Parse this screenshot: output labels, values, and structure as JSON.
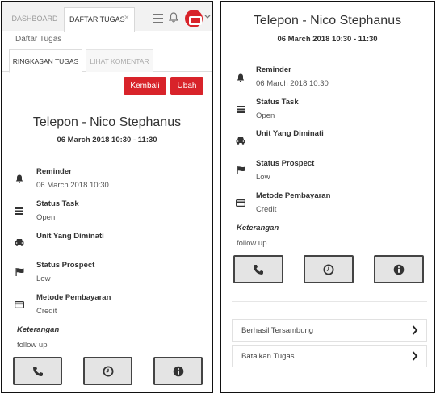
{
  "left": {
    "tabs": {
      "dashboard": "DASHBOARD",
      "daftar": "DAFTAR TUGAS",
      "close": "×"
    },
    "page_subtitle": "Daftar Tugas",
    "subtabs": {
      "ringkasan": "RINGKASAN TUGAS",
      "komentar": "LIHAT KOMENTAR"
    },
    "buttons": {
      "kembali": "Kembali",
      "ubah": "Ubah"
    },
    "accent": "#d8232a"
  },
  "task": {
    "title": "Telepon - Nico Stephanus",
    "datetime": "06 March 2018 10:30 - 11:30",
    "fields": [
      {
        "icon": "bell-icon",
        "label": "Reminder",
        "value": "06 March 2018 10:30"
      },
      {
        "icon": "list-icon",
        "label": "Status Task",
        "value": "Open"
      },
      {
        "icon": "car-icon",
        "label": "Unit Yang Diminati",
        "value": ""
      },
      {
        "icon": "flag-icon",
        "label": "Status Prospect",
        "value": "Low"
      },
      {
        "icon": "credit-card-icon",
        "label": "Metode Pembayaran",
        "value": "Credit"
      }
    ],
    "keterangan_label": "Keterangan",
    "keterangan_value": "follow up"
  },
  "actions": [
    "phone-icon",
    "clock-icon",
    "info-icon"
  ],
  "right": {
    "list_items": [
      "Berhasil Tersambung",
      "Batalkan Tugas"
    ]
  }
}
